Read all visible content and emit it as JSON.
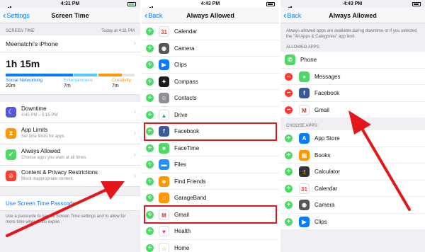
{
  "panel1": {
    "status_time": "4:31 PM",
    "back_label": "Settings",
    "title": "Screen Time",
    "section_label": "SCREEN TIME",
    "section_date": "Today at 4:31 PM",
    "device_name": "Meenatchi's iPhone",
    "total_time": "1h 15m",
    "categories": [
      {
        "label": "Social Networking",
        "value": "20m",
        "color": "#0a7aff"
      },
      {
        "label": "Entertainment",
        "value": "7m",
        "color": "#5ac8fa"
      },
      {
        "label": "Creativity",
        "value": "7m",
        "color": "#ff9500"
      }
    ],
    "options": [
      {
        "title": "Downtime",
        "subtitle": "4:45 PM – 5:15 PM",
        "icon": "moon-icon",
        "color": "#5856d6"
      },
      {
        "title": "App Limits",
        "subtitle": "Set time limits for apps.",
        "icon": "hourglass-icon",
        "color": "#ff9500"
      },
      {
        "title": "Always Allowed",
        "subtitle": "Choose apps you want at all times.",
        "icon": "check-icon",
        "color": "#4cd964"
      },
      {
        "title": "Content & Privacy Restrictions",
        "subtitle": "Block inappropriate content.",
        "icon": "no-entry-icon",
        "color": "#ff3b30"
      }
    ],
    "passcode_link": "Use Screen Time Passcode",
    "footnote": "Use a passcode to secure Screen Time settings and to allow for more time when limits expire."
  },
  "panel2": {
    "status_time": "4:43 PM",
    "back_label": "Back",
    "title": "Always Allowed",
    "apps": [
      {
        "name": "Calendar",
        "icon": "calendar-icon",
        "color": "#ffffff",
        "glyph": "31",
        "fg": "#ff3b30"
      },
      {
        "name": "Camera",
        "icon": "camera-icon",
        "color": "#555555",
        "glyph": "◉",
        "fg": "#ffffff"
      },
      {
        "name": "Clips",
        "icon": "clips-icon",
        "color": "#0a7aff",
        "glyph": "▶",
        "fg": "#ffffff"
      },
      {
        "name": "Compass",
        "icon": "compass-icon",
        "color": "#1c1c1e",
        "glyph": "✦",
        "fg": "#ffffff"
      },
      {
        "name": "Contacts",
        "icon": "contacts-icon",
        "color": "#8e8e93",
        "glyph": "☺",
        "fg": "#ffffff"
      },
      {
        "name": "Drive",
        "icon": "drive-icon",
        "color": "#ffffff",
        "glyph": "▲",
        "fg": "#34a853"
      },
      {
        "name": "Facebook",
        "icon": "facebook-icon",
        "color": "#3b5998",
        "glyph": "f",
        "fg": "#ffffff"
      },
      {
        "name": "FaceTime",
        "icon": "facetime-icon",
        "color": "#4cd964",
        "glyph": "■",
        "fg": "#ffffff"
      },
      {
        "name": "Files",
        "icon": "files-icon",
        "color": "#1e90ff",
        "glyph": "▬",
        "fg": "#ffffff"
      },
      {
        "name": "Find Friends",
        "icon": "find-friends-icon",
        "color": "#ff9500",
        "glyph": "☻",
        "fg": "#ffffff"
      },
      {
        "name": "GarageBand",
        "icon": "garageband-icon",
        "color": "#ff9500",
        "glyph": "♫",
        "fg": "#ffffff"
      },
      {
        "name": "Gmail",
        "icon": "gmail-icon",
        "color": "#ffffff",
        "glyph": "M",
        "fg": "#d93025"
      },
      {
        "name": "Health",
        "icon": "health-icon",
        "color": "#ffffff",
        "glyph": "♥",
        "fg": "#ff2d55"
      },
      {
        "name": "Home",
        "icon": "home-icon",
        "color": "#ffffff",
        "glyph": "⌂",
        "fg": "#ff9500"
      }
    ]
  },
  "panel3": {
    "status_time": "4:43 PM",
    "back_label": "Back",
    "title": "Always Allowed",
    "info": "Always-allowed apps are available during downtime or if you selected the \"All Apps & Categories\" app limit.",
    "allowed_header": "ALLOWED APPS:",
    "allowed": [
      {
        "name": "Phone",
        "icon": "phone-icon",
        "color": "#4cd964",
        "glyph": "✆",
        "fg": "#ffffff",
        "removable": false
      },
      {
        "name": "Messages",
        "icon": "messages-icon",
        "color": "#4cd964",
        "glyph": "●",
        "fg": "#ffffff",
        "removable": true
      },
      {
        "name": "Facebook",
        "icon": "facebook-icon",
        "color": "#3b5998",
        "glyph": "f",
        "fg": "#ffffff",
        "removable": true
      },
      {
        "name": "Gmail",
        "icon": "gmail-icon",
        "color": "#ffffff",
        "glyph": "M",
        "fg": "#d93025",
        "removable": true
      }
    ],
    "choose_header": "CHOOSE APPS:",
    "choose": [
      {
        "name": "App Store",
        "icon": "app-store-icon",
        "color": "#0a7aff",
        "glyph": "A",
        "fg": "#ffffff"
      },
      {
        "name": "Books",
        "icon": "books-icon",
        "color": "#ff9500",
        "glyph": "▤",
        "fg": "#ffffff"
      },
      {
        "name": "Calculator",
        "icon": "calculator-icon",
        "color": "#333333",
        "glyph": "±",
        "fg": "#ff9500"
      },
      {
        "name": "Calendar",
        "icon": "calendar-icon",
        "color": "#ffffff",
        "glyph": "31",
        "fg": "#ff3b30"
      },
      {
        "name": "Camera",
        "icon": "camera-icon",
        "color": "#555555",
        "glyph": "◉",
        "fg": "#ffffff"
      },
      {
        "name": "Clips",
        "icon": "clips-icon",
        "color": "#0a7aff",
        "glyph": "▶",
        "fg": "#ffffff"
      }
    ]
  },
  "colors": {
    "accent": "#0a7aff",
    "highlight": "#e3161b",
    "add": "#4cd964",
    "remove": "#ff3b30"
  }
}
